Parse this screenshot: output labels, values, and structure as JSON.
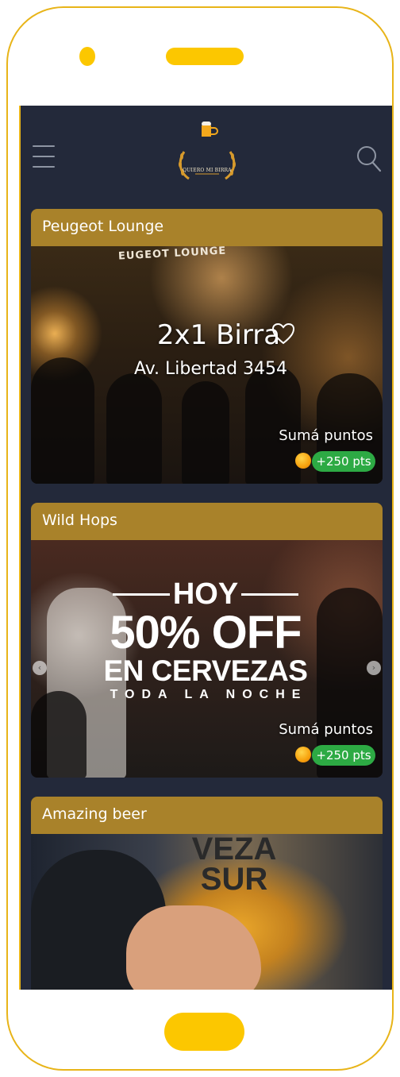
{
  "header": {
    "logo_text": "QUIERO MI BIRRA",
    "menu_icon": "hamburger-menu-icon",
    "search_icon": "search-icon"
  },
  "cards": [
    {
      "title": "Peugeot Lounge",
      "sign_text": "EUGEOT LOUNGE",
      "promo_title": "2x1 Birra",
      "promo_address": "Av. Libertad 3454",
      "points_label": "Sumá puntos",
      "points_badge": "+250 pts"
    },
    {
      "title": "Wild Hops",
      "banner_hoy": "HOY",
      "banner_off": "50% OFF",
      "banner_cervezas": "EN CERVEZAS",
      "banner_noche": "TODA LA NOCHE",
      "points_label": "Sumá puntos",
      "points_badge": "+250 pts",
      "arrow_left": "‹",
      "arrow_right": "›"
    },
    {
      "title": "Amazing beer",
      "glass_text": "VEZA SUR"
    }
  ],
  "colors": {
    "frame_accent": "#fcc700",
    "screen_bg": "#23293a",
    "card_header": "#a9822a",
    "points_badge": "#2daa44"
  }
}
